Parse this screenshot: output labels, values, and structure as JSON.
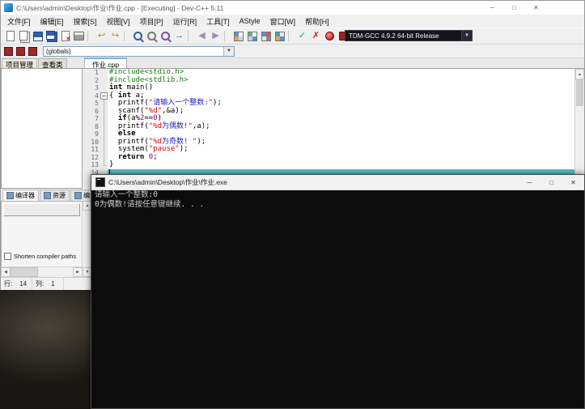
{
  "window": {
    "title": "C:\\Users\\admin\\Desktop\\作业\\作业.cpp - [Executing] - Dev-C++ 5.11",
    "minimize": "─",
    "maximize": "□",
    "close": "✕"
  },
  "menu": {
    "items": [
      {
        "name": "menu-file",
        "label": "文件[F]"
      },
      {
        "name": "menu-edit",
        "label": "编辑[E]"
      },
      {
        "name": "menu-search",
        "label": "搜索[S]"
      },
      {
        "name": "menu-view",
        "label": "视图[V]"
      },
      {
        "name": "menu-project",
        "label": "项目[P]"
      },
      {
        "name": "menu-run",
        "label": "运行[R]"
      },
      {
        "name": "menu-tools",
        "label": "工具[T]"
      },
      {
        "name": "menu-astyle",
        "label": "AStyle"
      },
      {
        "name": "menu-window",
        "label": "窗口[W]"
      },
      {
        "name": "menu-help",
        "label": "帮助[H]"
      }
    ]
  },
  "toolbar": {
    "compiler_profile": "TDM-GCC 4.9.2 64-bit Release",
    "class_browser": "(globals)",
    "main_icons": [
      {
        "name": "new-source-icon",
        "shape": "page"
      },
      {
        "name": "open-file-icon",
        "shape": "pages"
      },
      {
        "name": "save-icon",
        "shape": "save"
      },
      {
        "name": "save-all-icon",
        "shape": "saveall"
      },
      {
        "name": "close-file-icon",
        "shape": "closefile"
      },
      {
        "name": "print-icon",
        "shape": "print"
      },
      {
        "separator": true
      },
      {
        "name": "undo-icon",
        "shape": "glyph",
        "glyph": "↩",
        "color": "#c79100"
      },
      {
        "name": "redo-icon",
        "shape": "glyph",
        "glyph": "↪",
        "color": "#c79100"
      },
      {
        "separator": true
      },
      {
        "name": "find-icon",
        "shape": "find"
      },
      {
        "name": "find-in-files-icon",
        "shape": "findfiles"
      },
      {
        "name": "replace-icon",
        "shape": "replace"
      },
      {
        "name": "goto-line-icon",
        "shape": "glyph",
        "glyph": "→",
        "color": "#2f5fa8"
      },
      {
        "separator": true
      },
      {
        "name": "back-icon",
        "shape": "glyph",
        "glyph": "◀",
        "color": "#9b8fae"
      },
      {
        "name": "forward-icon",
        "shape": "glyph",
        "glyph": "▶",
        "color": "#9b8fae"
      },
      {
        "separator": true
      },
      {
        "name": "new-project-icon",
        "shape": "grid-a"
      },
      {
        "name": "remove-file-icon",
        "shape": "grid-b"
      },
      {
        "name": "project-options-icon",
        "shape": "grid-c"
      },
      {
        "name": "compile-icon",
        "shape": "grid-d"
      },
      {
        "separator": true
      },
      {
        "name": "compile-run-icon",
        "shape": "glyph",
        "glyph": "✓",
        "color": "#1f9e9e"
      },
      {
        "name": "stop-execution-icon",
        "shape": "glyph",
        "glyph": "✗",
        "color": "#cc1f1f"
      },
      {
        "name": "debug-icon",
        "shape": "reddot"
      },
      {
        "name": "profile-icon",
        "shape": "redbook"
      }
    ],
    "mini_icons": [
      {
        "name": "new-unit-icon"
      },
      {
        "name": "toggle-bookmark-icon"
      },
      {
        "name": "goto-bookmark-icon"
      }
    ]
  },
  "project_panel": {
    "tabs": [
      {
        "name": "tab-project-manager",
        "label": "项目管理",
        "active": true
      },
      {
        "name": "tab-class-view",
        "label": "查看类",
        "active": false
      }
    ]
  },
  "editor": {
    "tab_label": "作业.cpp",
    "current_line": 14,
    "lines": [
      {
        "n": 1,
        "fold": "",
        "seg": [
          [
            "pp",
            "#include<stdio.h>"
          ]
        ]
      },
      {
        "n": 2,
        "fold": "",
        "seg": [
          [
            "pp",
            "#include<stdlib.h>"
          ]
        ]
      },
      {
        "n": 3,
        "fold": "",
        "seg": [
          [
            "kw",
            "int"
          ],
          [
            "pl",
            " main()"
          ]
        ]
      },
      {
        "n": 4,
        "fold": "box",
        "seg": [
          [
            "pl",
            "{ "
          ],
          [
            "kw",
            "int"
          ],
          [
            "pl",
            " a;"
          ]
        ]
      },
      {
        "n": 5,
        "fold": "bar",
        "seg": [
          [
            "pl",
            "  printf("
          ],
          [
            "st",
            "\""
          ],
          [
            "sc",
            "请输入一个整数:"
          ],
          [
            "st",
            "\""
          ],
          [
            "pl",
            ");"
          ]
        ]
      },
      {
        "n": 6,
        "fold": "bar",
        "seg": [
          [
            "pl",
            "  scanf("
          ],
          [
            "st",
            "\"%d\""
          ],
          [
            "pl",
            ",&a);"
          ]
        ]
      },
      {
        "n": 7,
        "fold": "bar",
        "seg": [
          [
            "pl",
            "  "
          ],
          [
            "kw",
            "if"
          ],
          [
            "pl",
            "(a%"
          ],
          [
            "nu",
            "2"
          ],
          [
            "pl",
            "=="
          ],
          [
            "nu",
            "0"
          ],
          [
            "pl",
            ")"
          ]
        ]
      },
      {
        "n": 8,
        "fold": "bar",
        "seg": [
          [
            "pl",
            "  printf("
          ],
          [
            "st",
            "\"%d"
          ],
          [
            "sc",
            "为偶数!"
          ],
          [
            "st",
            "\""
          ],
          [
            "pl",
            ",a);"
          ]
        ]
      },
      {
        "n": 9,
        "fold": "bar",
        "seg": [
          [
            "pl",
            "  "
          ],
          [
            "kw",
            "else"
          ]
        ]
      },
      {
        "n": 10,
        "fold": "bar",
        "seg": [
          [
            "pl",
            "  printf("
          ],
          [
            "st",
            "\"%d"
          ],
          [
            "sc",
            "为奇数!"
          ],
          [
            "st",
            " \""
          ],
          [
            "pl",
            ");"
          ]
        ]
      },
      {
        "n": 11,
        "fold": "bar",
        "seg": [
          [
            "pl",
            "  system("
          ],
          [
            "st",
            "\"pause\""
          ],
          [
            "pl",
            ");"
          ]
        ]
      },
      {
        "n": 12,
        "fold": "bar",
        "seg": [
          [
            "pl",
            "  "
          ],
          [
            "kw",
            "return"
          ],
          [
            "pl",
            " "
          ],
          [
            "nu",
            "0"
          ],
          [
            "pl",
            ";"
          ]
        ]
      },
      {
        "n": 13,
        "fold": "end",
        "seg": [
          [
            "pl",
            "}"
          ]
        ]
      },
      {
        "n": 14,
        "fold": "",
        "seg": []
      }
    ]
  },
  "report_panel": {
    "tabs": [
      {
        "name": "tab-compiler",
        "label": "编译器",
        "active": true
      },
      {
        "name": "tab-resources",
        "label": "资源",
        "active": false
      },
      {
        "name": "tab-compile-log",
        "label": "编译日志",
        "active": false
      }
    ],
    "shorten_compiler_paths": "Shorten compiler paths"
  },
  "statusbar": {
    "row_label": "行:",
    "row_value": "14",
    "col_label": "列:",
    "col_value": "1"
  },
  "console": {
    "title": "C:\\Users\\admin\\Desktop\\作业\\作业.exe",
    "minimize": "─",
    "maximize": "□",
    "close": "✕",
    "lines": [
      "请输入一个整数:0",
      "0为偶数!请按任意键继续. . ."
    ]
  }
}
